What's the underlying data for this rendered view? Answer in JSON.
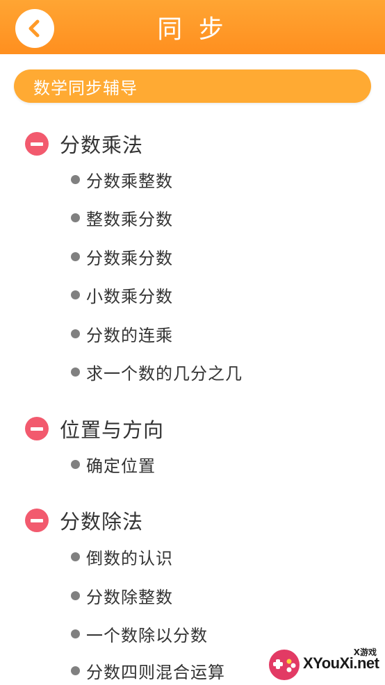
{
  "header": {
    "title": "同 步",
    "back_icon": "chevron-left-icon"
  },
  "banner": {
    "label": "数学同步辅导"
  },
  "chapters": [
    {
      "title": "分数乘法",
      "lessons": [
        "分数乘整数",
        "整数乘分数",
        "分数乘分数",
        "小数乘分数",
        "分数的连乘",
        "求一个数的几分之几"
      ]
    },
    {
      "title": "位置与方向",
      "lessons": [
        "确定位置"
      ]
    },
    {
      "title": "分数除法",
      "lessons": [
        "倒数的认识",
        "分数除整数",
        "一个数除以分数",
        "分数四则混合运算"
      ]
    }
  ],
  "watermark": {
    "small": "X游戏",
    "text": "XYouXi.net"
  },
  "colors": {
    "header": "#ff9a28",
    "banner": "#ffaa33",
    "collapse_icon": "#f25a6e",
    "bullet": "#808080"
  }
}
